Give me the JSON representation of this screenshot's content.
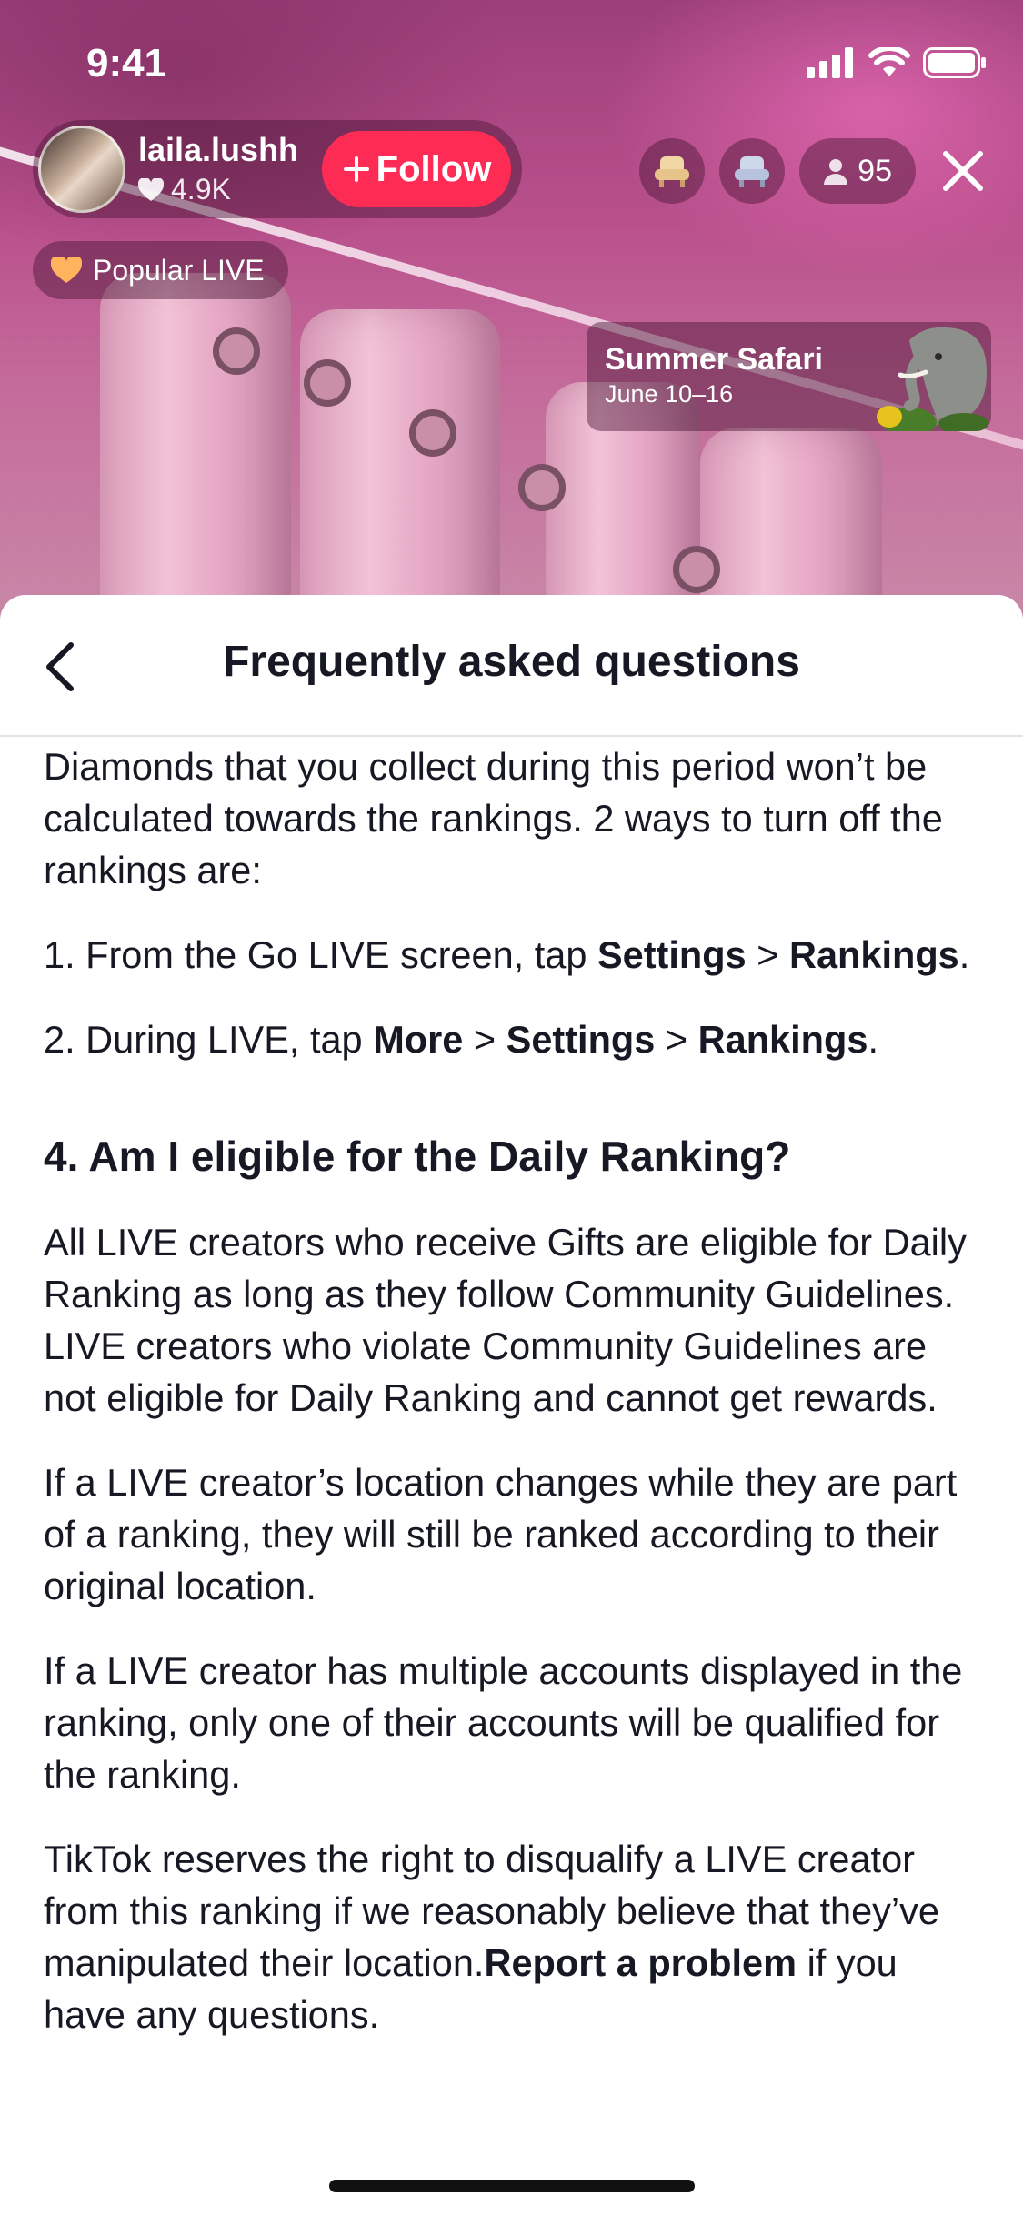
{
  "status_bar": {
    "time": "9:41"
  },
  "host": {
    "username": "laila.lushh",
    "likes": "4.9K",
    "follow_label": "Follow"
  },
  "viewers": {
    "count": "95"
  },
  "badge": {
    "label": "Popular LIVE"
  },
  "event": {
    "title": "Summer Safari",
    "dates": "June 10–16"
  },
  "sheet": {
    "title": "Frequently asked questions"
  },
  "faq": {
    "intro": "Diamonds that you collect during this period won’t be calculated towards the rankings. 2 ways to turn off the rankings are:",
    "step1": {
      "prefix": "1. From the Go LIVE screen, tap ",
      "settings": "Settings",
      "sep": " > ",
      "rankings": "Rankings",
      "end": "."
    },
    "step2": {
      "prefix": "2. During LIVE, tap ",
      "more": "More",
      "sep1": " > ",
      "settings": "Settings",
      "sep2": " > ",
      "rankings": "Rankings",
      "end": "."
    },
    "q4_heading": "4. Am I eligible for the Daily Ranking?",
    "p1": "All LIVE creators who receive Gifts are eligible for Daily Ranking as long as they follow Community Guidelines. LIVE creators who violate Community Guidelines are not eligible for Daily Ranking and cannot get rewards.",
    "p2": "If a LIVE creator’s location changes while they are part of a ranking, they will still be ranked according to their original location.",
    "p3": "If a LIVE creator has multiple accounts displayed in the ranking, only one of their accounts will be qualified for the ranking.",
    "p4": {
      "text": "TikTok reserves the right to disqualify a LIVE creator from this ranking if we reasonably believe that they’ve manipulated their location.",
      "link": "Report a problem",
      "end": " if you have any questions."
    }
  },
  "colors": {
    "follow": "#fe2c55",
    "text": "#161823"
  }
}
